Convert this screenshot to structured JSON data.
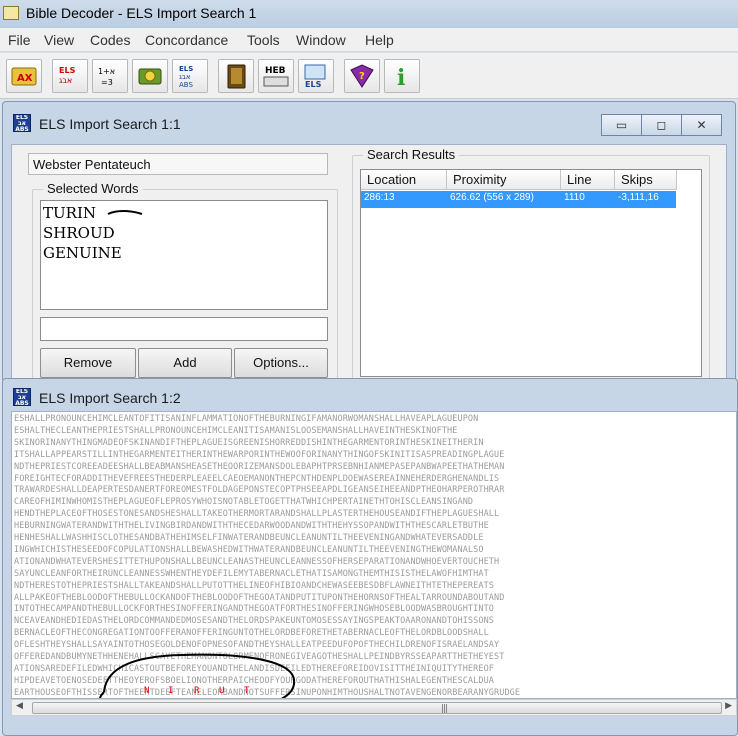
{
  "app": {
    "title": "Bible Decoder - ELS Import Search 1"
  },
  "menu": [
    "File",
    "View",
    "Codes",
    "Concordance",
    "Tools",
    "Window",
    "Help"
  ],
  "toolbar": {
    "buttons": [
      "book-search-icon",
      "els-icon",
      "gematria-icon",
      "concordance-icon",
      "els-table-icon",
      "bible-icon",
      "hebrew-keyboard-icon",
      "els-export-icon",
      "help-book-icon",
      "info-icon"
    ],
    "labels": {
      "heb": "HEB",
      "els": "ELS",
      "gematria": "1+2=3"
    }
  },
  "window1": {
    "title": "ELS Import Search 1:1",
    "caption": {
      "minimize": "▭",
      "restore": "◻",
      "close": "✕"
    },
    "database": "Webster Pentateuch",
    "selected_words_label": "Selected Words",
    "words": [
      "TURIN",
      "SHROUD",
      "GENUINE"
    ],
    "buttons": {
      "remove": "Remove",
      "add": "Add",
      "options": "Options..."
    },
    "search_results_label": "Search Results",
    "columns": [
      "Location",
      "Proximity",
      "Line",
      "Skips"
    ],
    "rows": [
      {
        "location": "286:13",
        "proximity": "626.62 (556 x 289)",
        "line": "1110",
        "skips": "-3,111,16"
      }
    ]
  },
  "window2": {
    "title": "ELS Import Search 1:2",
    "highlighted_letters": [
      "N",
      "I",
      "R",
      "U",
      "T"
    ],
    "scrollbar_grip": "|||",
    "text_lines": [
      "ESHALLPRONOUNCEHIMCLEANTOFITISANINFLAMMATIONOFTHEBURNINGIFAMANORWOMANSHALLHAVEAPLAGUEUPON",
      "ESHALTHECLEANTHEPRIESTSHALLPRONOUNCEHIMCLEANITISAMANISLOOSEMANSHALLHAVEINTHESKINOFTHE",
      "SKINORINANYTHINGMADEOFSKINANDIFTHEPLAGUEISGREENISHORREDDISHINTHEGARMENTORINTHESKINEITHERIN",
      "ITSHALLAPPEARSTILLINTHEGARMENTEITHERINTHEWARPORINTHEWOOFORINANYTHINGOFSKINITISASPREADINGPLAGUE",
      "NDTHEPRIESTCOREEADEESHALLBEABMANSHEASETHEOORIZEMANSDOLEBAPHTPRSEBNHIANMEPASEPANBWAPEETHATHEMAN",
      "FOREIGHTECFORADDITHEVEFREESTHEDERPLEAEELCAEOEMANONTHEPCNTHDENPLDOEWASEREAINNEHERDERGHENANDLIS",
      "TRAWARDESHALLDEAPERTESDANERTFOREOMESTFOLDAGEPONSTECOPTPHSEEAPDLIGEANSEIHEEANDPTHEOHARPEROTHRAR",
      "CAREOFHIMINWHOMISTHEPLAGUEOFLEPROSYWHOISNOTABLETOGETTHATWHICHPERTAINETHTOHISCLEANSINGAND",
      "HENDTHEPLACEOFTHOSESTONESANDSHESHALLTAKEOTHERMORTARANDSHALLPLASTERTHEHOUSEANDIFTHEPLAGUESHALL",
      "HEBURNINGWATERANDWITHTHELIVINGBIRDANDWITHTHECEDARWOODANDWITHTHEHYSSOPANDWITHTHESCARLETBUTHE",
      "HENHESHALLWASHHISCLOTHESANDBATHEHIMSELFINWATERANDBEUNCLEANUNTILTHEEVENINGANDWHATEVERSADDLE",
      "INGWHICHISTHESEEDOFCOPULATIONSHALLBEWASHEDWITHWATERANDBEUNCLEANUNTILTHEEVENINGTHEWOMANALSO",
      "ATIONANDWHATEVERSHESITTETHUPONSHALLBEUNCLEANASTHEUNCLEANNESSOFHERSEPARATIONANDWHOEVERTOUCHETH",
      "SAYUNCLEANFORTHEIRUNCLEANNESSWHENTHEYDEFILEMYTABERNACLETHATISAMONGTHEMTHISISTHELAWOFHIMTHAT",
      "NDTHERESTOTHEPRIESTSHALLTAKEANDSHALLPUTOTTHELINEOFHIBIOANDCHEWASEEBESDBFLAWNEITHTETHEPEREATS",
      "ALLPAKEOFTHEBLOODOFTHEBULLOCKANDOFTHEBLOODOFTHEGOATANDPUTITUPONTHEHORNSOFTHEALTARROUNDABOUTAND",
      "INTOTHECAMPANDTHEBULLOCKFORTHESINOFFERINGANDTHEGOATFORTHESINOFFERINGWHOSEBLOODWASBROUGHTINTO",
      "NCEAVEANDHEDIEDASTHELORDCOMMANDEDMOSESANDTHELORDSPAKEUNTOMOSESSAYINGSPEAKTOAARONANDTOHISSONS",
      "BERNACLEOFTHECONGREGATIONTOOFFERANOFFERINGUNTOTHELORDBEFORETHETABERNACLEOFTHELORDBLOODSHALL",
      "OFLESHTHEYSHALLSAYAINTOTHOSEGOLDENOFOPNESOFANDTHEYSHALLEATPEEDUFOPOFTHECHILDRENOFISRAELANDSAY",
      "OFFEREDANDBUMYNETHHENEHALLSCAYETHEMANONTOLORMENOFRONEGIVEAGOTHESHALLPEINDBYRSSEAPARTTHETHEYEST",
      "ATIONSAREDEFILEDWHICHICASTOUTBEFOREYOUANDTHELANDISDEFILEDTHEREFOREIDOVISITTHEINIQUITYTHEREOF",
      "HIPDEAVETOENOSEDEFTTHEOYEROFSBOELIONOTHERPAICHEOOFYOURGODATHEREFOROUTHATHISHALEGENTHESCALDUA",
      "EARTHOUSEOFTHISSERTOFTHEERTDEEFTEANELEORBANDNOTSUFFERSINUPONHIMTHOUSHALTNOTAVENGENORBEARANYGRUDGE"
    ]
  }
}
